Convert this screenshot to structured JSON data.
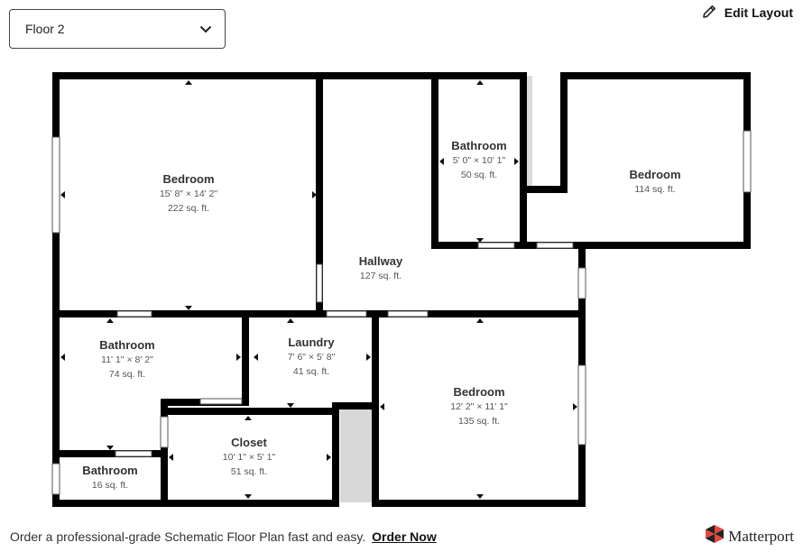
{
  "floor_selector": {
    "value": "Floor 2",
    "icon": "chevron-down-icon"
  },
  "edit_layout": {
    "label": "Edit Layout",
    "icon": "pencil-icon"
  },
  "rooms": [
    {
      "id": "bedroom-1",
      "name": "Bedroom",
      "dims": "15' 8\" × 14' 2\"",
      "area": "222 sq. ft."
    },
    {
      "id": "hallway",
      "name": "Hallway",
      "area": "127 sq. ft."
    },
    {
      "id": "bathroom-top",
      "name": "Bathroom",
      "dims": "5' 0\" × 10' 1\"",
      "area": "50 sq. ft."
    },
    {
      "id": "bedroom-2",
      "name": "Bedroom",
      "area": "114 sq. ft."
    },
    {
      "id": "bathroom-2",
      "name": "Bathroom",
      "dims": "11' 1\" × 8' 2\"",
      "area": "74 sq. ft."
    },
    {
      "id": "laundry",
      "name": "Laundry",
      "dims": "7' 6\" × 5' 8\"",
      "area": "41 sq. ft."
    },
    {
      "id": "bedroom-3",
      "name": "Bedroom",
      "dims": "12' 2\" × 11' 1\"",
      "area": "135 sq. ft."
    },
    {
      "id": "closet",
      "name": "Closet",
      "dims": "10' 1\" × 5' 1\"",
      "area": "51 sq. ft."
    },
    {
      "id": "bathroom-small",
      "name": "Bathroom",
      "area": "16 sq. ft."
    }
  ],
  "footer": {
    "text": "Order a professional-grade Schematic Floor Plan fast and easy.",
    "link": "Order Now"
  },
  "brand": {
    "name": "Matterport",
    "logo_colors": [
      "#e8473d",
      "#222222"
    ]
  }
}
